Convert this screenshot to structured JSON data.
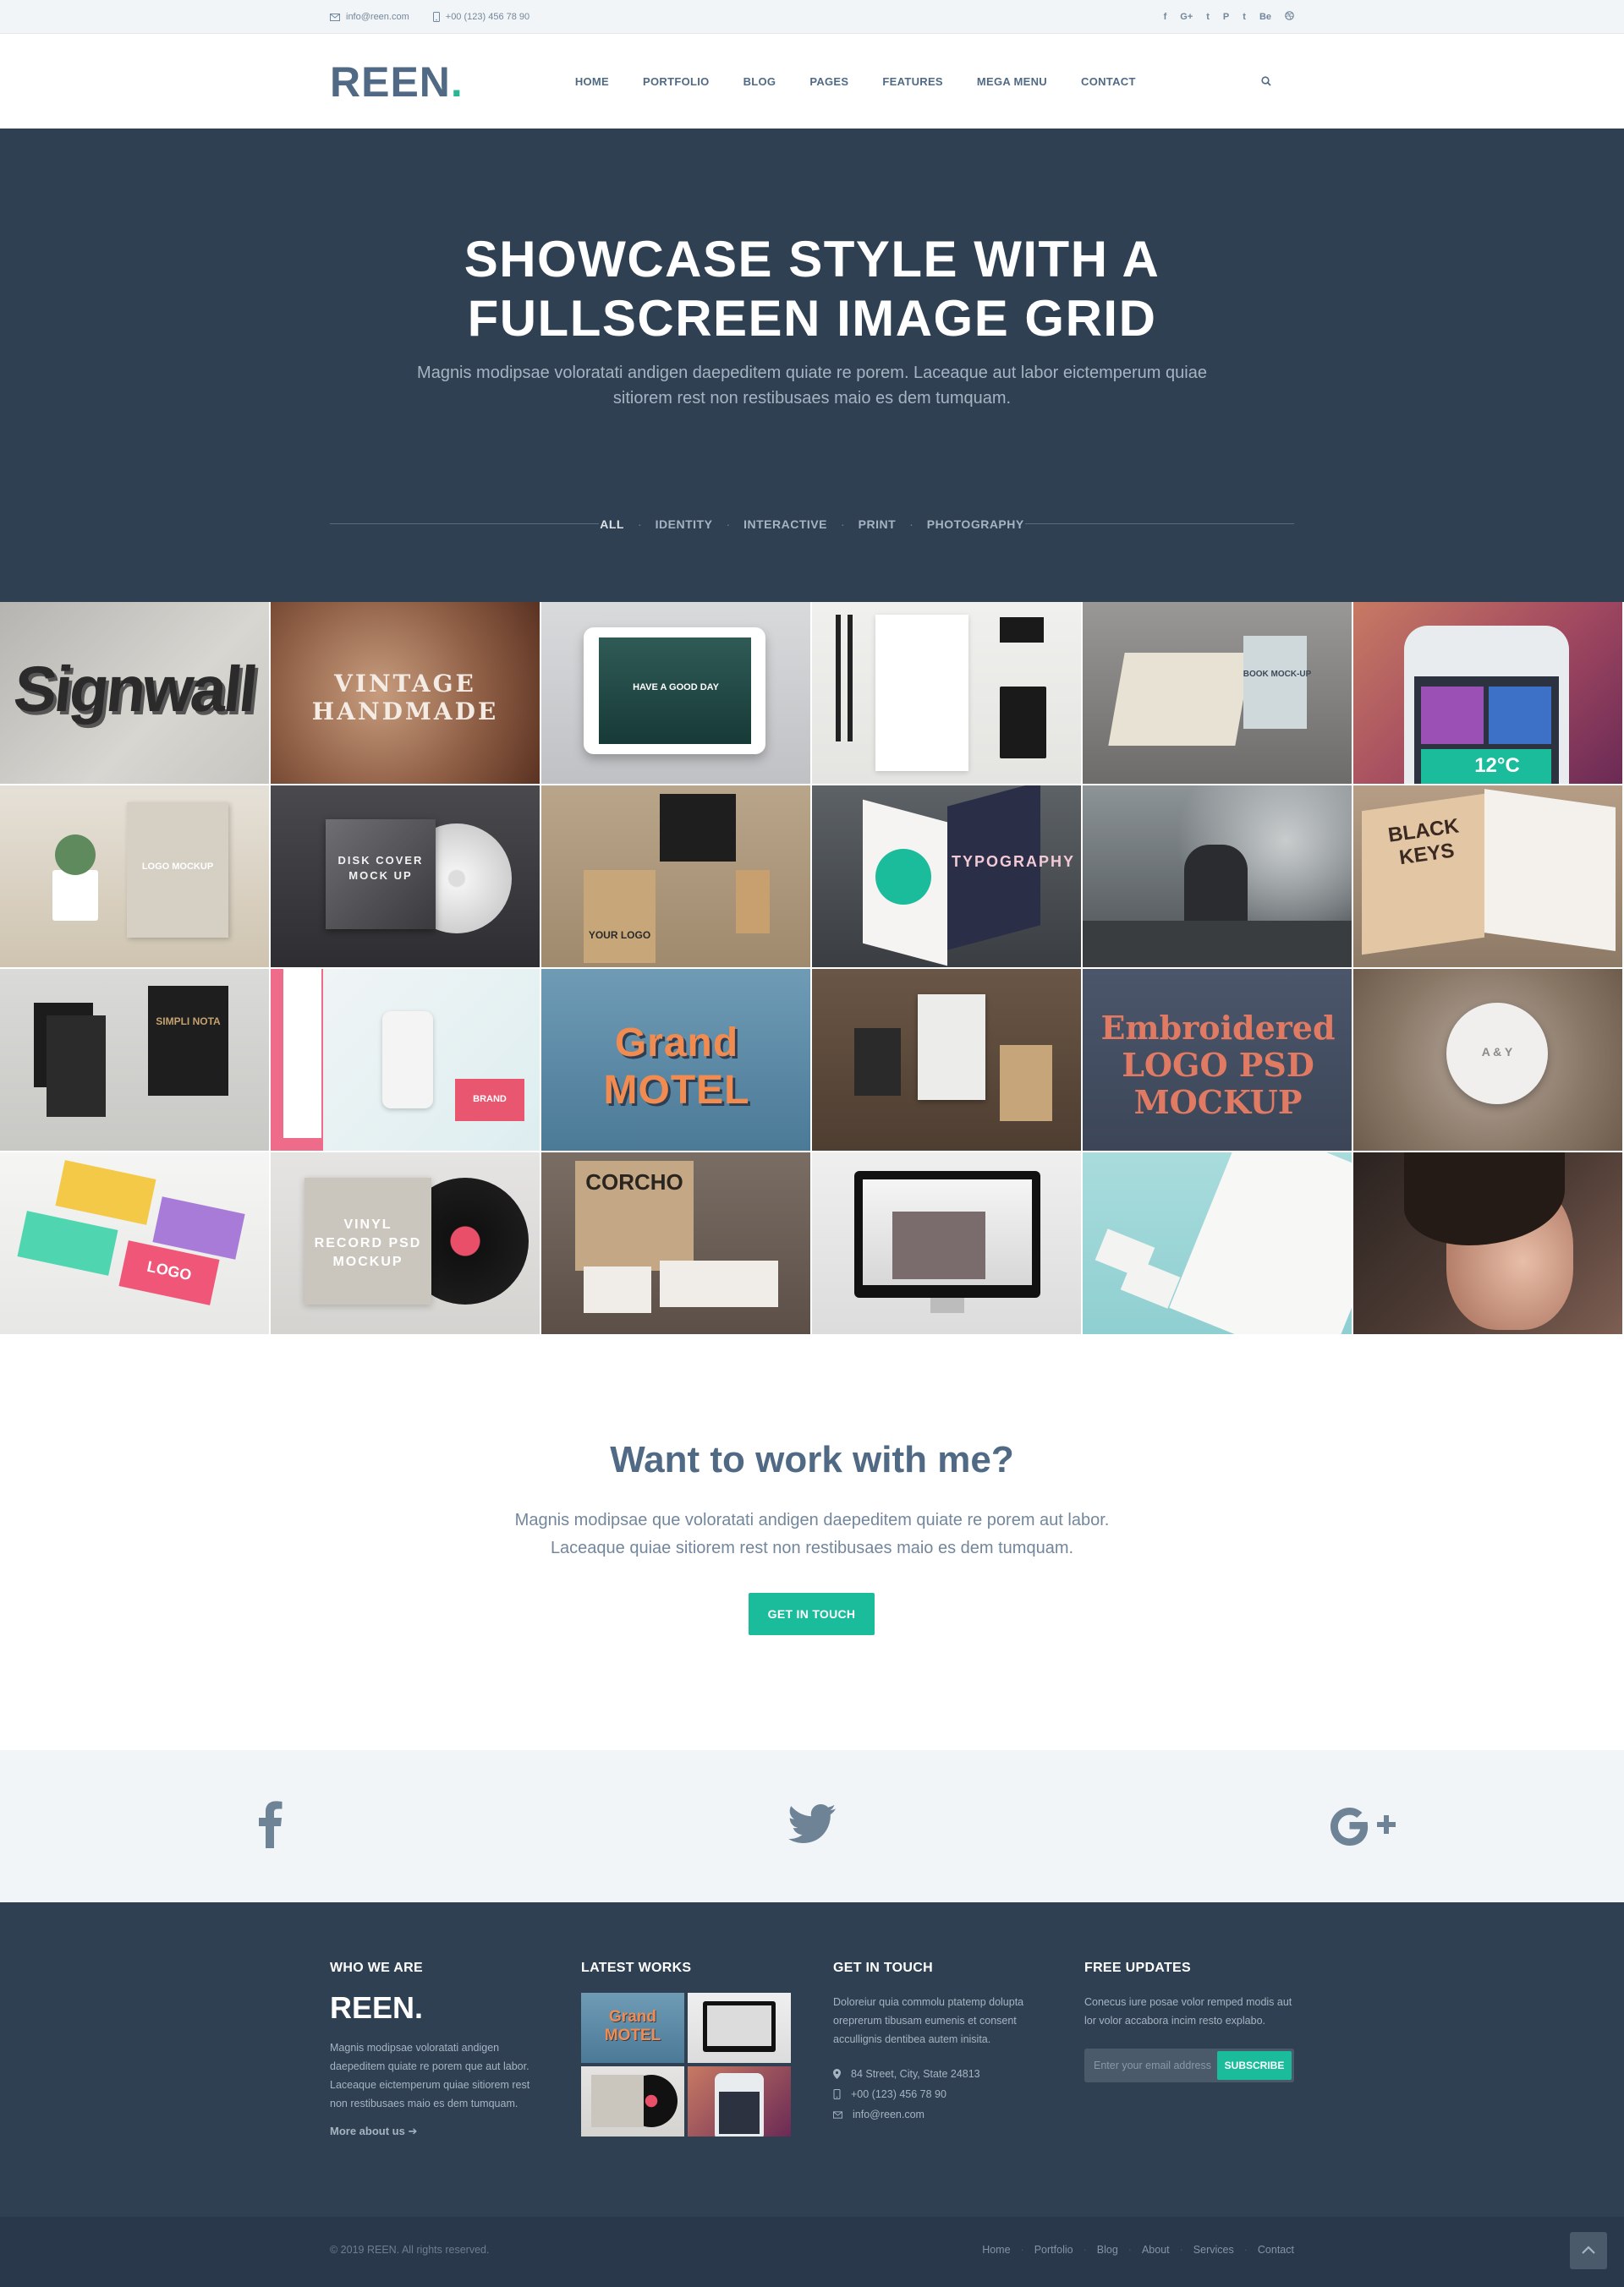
{
  "topbar": {
    "email": "info@reen.com",
    "phone": "+00 (123) 456 78 90",
    "socials": [
      "f",
      "G+",
      "t",
      "P",
      "t",
      "Be",
      "d"
    ]
  },
  "header": {
    "logo": "REEN",
    "logo_dot": ".",
    "nav": [
      "HOME",
      "PORTFOLIO",
      "BLOG",
      "PAGES",
      "FEATURES",
      "MEGA MENU",
      "CONTACT"
    ]
  },
  "hero": {
    "title_line1": "SHOWCASE STYLE WITH A",
    "title_line2": "FULLSCREEN IMAGE GRID",
    "subtitle": "Magnis modipsae voloratati andigen daepeditem quiate re porem. Laceaque aut labor eictemperum quiae sitiorem rest non restibusaes maio es dem tumquam.",
    "filters": [
      "ALL",
      "IDENTITY",
      "INTERACTIVE",
      "PRINT",
      "PHOTOGRAPHY"
    ]
  },
  "grid": {
    "tiles": [
      {
        "text": "Signwall"
      },
      {
        "text": "VINTAGE HANDMADE"
      },
      {
        "text": "HAVE A GOOD DAY"
      },
      {
        "text": ""
      },
      {
        "text": "BOOK MOCK-UP"
      },
      {
        "text": "12°C"
      },
      {
        "text": "LOGO MOCKUP"
      },
      {
        "text": "DISK COVER MOCK UP"
      },
      {
        "text": "YOUR LOGO"
      },
      {
        "text": "TYPOGRAPHY"
      },
      {
        "text": ""
      },
      {
        "text": "BLACK KEYS"
      },
      {
        "text": "SIMPLI NOTA"
      },
      {
        "text": "BRAND"
      },
      {
        "text": "Grand MOTEL"
      },
      {
        "text": ""
      },
      {
        "text": "Embroidered LOGO PSD MOCKUP"
      },
      {
        "text": "A & Y"
      },
      {
        "text": "LOGO"
      },
      {
        "text": "VINYL RECORD PSD MOCKUP"
      },
      {
        "text": "CORCHO"
      },
      {
        "text": ""
      },
      {
        "text": ""
      },
      {
        "text": ""
      }
    ]
  },
  "cta": {
    "title": "Want to work with me?",
    "line1": "Magnis modipsae que voloratati andigen daepeditem quiate re porem aut labor.",
    "line2": "Laceaque quiae sitiorem rest non restibusaes maio es dem tumquam.",
    "button": "GET IN TOUCH"
  },
  "footer": {
    "who_title": "WHO WE ARE",
    "who_logo": "REEN.",
    "who_text": "Magnis modipsae voloratati andigen daepeditem quiate re porem que aut labor. Laceaque eictemperum quiae sitiorem rest non restibusaes maio es dem tumquam.",
    "who_more": "More about us",
    "works_title": "LATEST WORKS",
    "touch_title": "GET IN TOUCH",
    "touch_text": "Doloreiur quia commolu ptatemp dolupta oreprerum tibusam eumenis et consent accullignis dentibea autem inisita.",
    "address": "84 Street, City, State 24813",
    "phone": "+00 (123) 456 78 90",
    "email": "info@reen.com",
    "updates_title": "FREE UPDATES",
    "updates_text": "Conecus iure posae volor remped modis aut lor volor accabora incim resto explabo.",
    "email_placeholder": "Enter your email address",
    "subscribe": "SUBSCRIBE"
  },
  "bottom": {
    "copyright": "© 2019 REEN. All rights reserved.",
    "links": [
      "Home",
      "Portfolio",
      "Blog",
      "About",
      "Services",
      "Contact"
    ]
  },
  "colors": {
    "primary": "#506a85",
    "dark": "#2f4052",
    "accent": "#1abc9c",
    "light_bg": "#f2f5f7"
  }
}
